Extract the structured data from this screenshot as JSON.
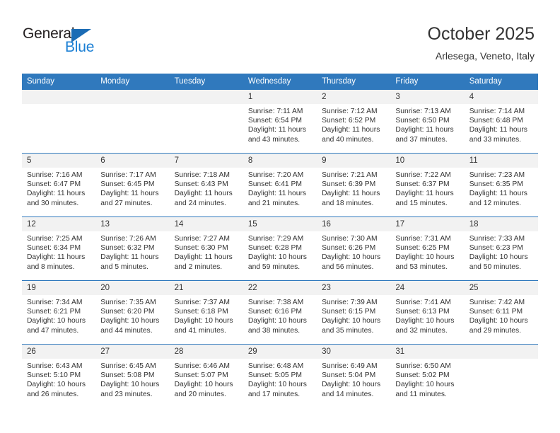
{
  "brand": {
    "name_part1": "General",
    "name_part2": "Blue",
    "accent_color": "#1b7fd4",
    "triangle_color": "#1b6cb5"
  },
  "header": {
    "title": "October 2025",
    "subtitle": "Arlesega, Veneto, Italy",
    "header_bg": "#3079bd",
    "daynum_bg": "#f2f2f2"
  },
  "weekday_headers": [
    "Sunday",
    "Monday",
    "Tuesday",
    "Wednesday",
    "Thursday",
    "Friday",
    "Saturday"
  ],
  "labels": {
    "sunrise_prefix": "Sunrise:",
    "sunset_prefix": "Sunset:",
    "daylight_prefix": "Daylight:"
  },
  "weeks": [
    [
      {
        "day": "",
        "sunrise": "",
        "sunset": "",
        "daylight_line1": "",
        "daylight_line2": ""
      },
      {
        "day": "",
        "sunrise": "",
        "sunset": "",
        "daylight_line1": "",
        "daylight_line2": ""
      },
      {
        "day": "",
        "sunrise": "",
        "sunset": "",
        "daylight_line1": "",
        "daylight_line2": ""
      },
      {
        "day": "1",
        "sunrise": "Sunrise: 7:11 AM",
        "sunset": "Sunset: 6:54 PM",
        "daylight_line1": "Daylight: 11 hours",
        "daylight_line2": "and 43 minutes."
      },
      {
        "day": "2",
        "sunrise": "Sunrise: 7:12 AM",
        "sunset": "Sunset: 6:52 PM",
        "daylight_line1": "Daylight: 11 hours",
        "daylight_line2": "and 40 minutes."
      },
      {
        "day": "3",
        "sunrise": "Sunrise: 7:13 AM",
        "sunset": "Sunset: 6:50 PM",
        "daylight_line1": "Daylight: 11 hours",
        "daylight_line2": "and 37 minutes."
      },
      {
        "day": "4",
        "sunrise": "Sunrise: 7:14 AM",
        "sunset": "Sunset: 6:48 PM",
        "daylight_line1": "Daylight: 11 hours",
        "daylight_line2": "and 33 minutes."
      }
    ],
    [
      {
        "day": "5",
        "sunrise": "Sunrise: 7:16 AM",
        "sunset": "Sunset: 6:47 PM",
        "daylight_line1": "Daylight: 11 hours",
        "daylight_line2": "and 30 minutes."
      },
      {
        "day": "6",
        "sunrise": "Sunrise: 7:17 AM",
        "sunset": "Sunset: 6:45 PM",
        "daylight_line1": "Daylight: 11 hours",
        "daylight_line2": "and 27 minutes."
      },
      {
        "day": "7",
        "sunrise": "Sunrise: 7:18 AM",
        "sunset": "Sunset: 6:43 PM",
        "daylight_line1": "Daylight: 11 hours",
        "daylight_line2": "and 24 minutes."
      },
      {
        "day": "8",
        "sunrise": "Sunrise: 7:20 AM",
        "sunset": "Sunset: 6:41 PM",
        "daylight_line1": "Daylight: 11 hours",
        "daylight_line2": "and 21 minutes."
      },
      {
        "day": "9",
        "sunrise": "Sunrise: 7:21 AM",
        "sunset": "Sunset: 6:39 PM",
        "daylight_line1": "Daylight: 11 hours",
        "daylight_line2": "and 18 minutes."
      },
      {
        "day": "10",
        "sunrise": "Sunrise: 7:22 AM",
        "sunset": "Sunset: 6:37 PM",
        "daylight_line1": "Daylight: 11 hours",
        "daylight_line2": "and 15 minutes."
      },
      {
        "day": "11",
        "sunrise": "Sunrise: 7:23 AM",
        "sunset": "Sunset: 6:35 PM",
        "daylight_line1": "Daylight: 11 hours",
        "daylight_line2": "and 12 minutes."
      }
    ],
    [
      {
        "day": "12",
        "sunrise": "Sunrise: 7:25 AM",
        "sunset": "Sunset: 6:34 PM",
        "daylight_line1": "Daylight: 11 hours",
        "daylight_line2": "and 8 minutes."
      },
      {
        "day": "13",
        "sunrise": "Sunrise: 7:26 AM",
        "sunset": "Sunset: 6:32 PM",
        "daylight_line1": "Daylight: 11 hours",
        "daylight_line2": "and 5 minutes."
      },
      {
        "day": "14",
        "sunrise": "Sunrise: 7:27 AM",
        "sunset": "Sunset: 6:30 PM",
        "daylight_line1": "Daylight: 11 hours",
        "daylight_line2": "and 2 minutes."
      },
      {
        "day": "15",
        "sunrise": "Sunrise: 7:29 AM",
        "sunset": "Sunset: 6:28 PM",
        "daylight_line1": "Daylight: 10 hours",
        "daylight_line2": "and 59 minutes."
      },
      {
        "day": "16",
        "sunrise": "Sunrise: 7:30 AM",
        "sunset": "Sunset: 6:26 PM",
        "daylight_line1": "Daylight: 10 hours",
        "daylight_line2": "and 56 minutes."
      },
      {
        "day": "17",
        "sunrise": "Sunrise: 7:31 AM",
        "sunset": "Sunset: 6:25 PM",
        "daylight_line1": "Daylight: 10 hours",
        "daylight_line2": "and 53 minutes."
      },
      {
        "day": "18",
        "sunrise": "Sunrise: 7:33 AM",
        "sunset": "Sunset: 6:23 PM",
        "daylight_line1": "Daylight: 10 hours",
        "daylight_line2": "and 50 minutes."
      }
    ],
    [
      {
        "day": "19",
        "sunrise": "Sunrise: 7:34 AM",
        "sunset": "Sunset: 6:21 PM",
        "daylight_line1": "Daylight: 10 hours",
        "daylight_line2": "and 47 minutes."
      },
      {
        "day": "20",
        "sunrise": "Sunrise: 7:35 AM",
        "sunset": "Sunset: 6:20 PM",
        "daylight_line1": "Daylight: 10 hours",
        "daylight_line2": "and 44 minutes."
      },
      {
        "day": "21",
        "sunrise": "Sunrise: 7:37 AM",
        "sunset": "Sunset: 6:18 PM",
        "daylight_line1": "Daylight: 10 hours",
        "daylight_line2": "and 41 minutes."
      },
      {
        "day": "22",
        "sunrise": "Sunrise: 7:38 AM",
        "sunset": "Sunset: 6:16 PM",
        "daylight_line1": "Daylight: 10 hours",
        "daylight_line2": "and 38 minutes."
      },
      {
        "day": "23",
        "sunrise": "Sunrise: 7:39 AM",
        "sunset": "Sunset: 6:15 PM",
        "daylight_line1": "Daylight: 10 hours",
        "daylight_line2": "and 35 minutes."
      },
      {
        "day": "24",
        "sunrise": "Sunrise: 7:41 AM",
        "sunset": "Sunset: 6:13 PM",
        "daylight_line1": "Daylight: 10 hours",
        "daylight_line2": "and 32 minutes."
      },
      {
        "day": "25",
        "sunrise": "Sunrise: 7:42 AM",
        "sunset": "Sunset: 6:11 PM",
        "daylight_line1": "Daylight: 10 hours",
        "daylight_line2": "and 29 minutes."
      }
    ],
    [
      {
        "day": "26",
        "sunrise": "Sunrise: 6:43 AM",
        "sunset": "Sunset: 5:10 PM",
        "daylight_line1": "Daylight: 10 hours",
        "daylight_line2": "and 26 minutes."
      },
      {
        "day": "27",
        "sunrise": "Sunrise: 6:45 AM",
        "sunset": "Sunset: 5:08 PM",
        "daylight_line1": "Daylight: 10 hours",
        "daylight_line2": "and 23 minutes."
      },
      {
        "day": "28",
        "sunrise": "Sunrise: 6:46 AM",
        "sunset": "Sunset: 5:07 PM",
        "daylight_line1": "Daylight: 10 hours",
        "daylight_line2": "and 20 minutes."
      },
      {
        "day": "29",
        "sunrise": "Sunrise: 6:48 AM",
        "sunset": "Sunset: 5:05 PM",
        "daylight_line1": "Daylight: 10 hours",
        "daylight_line2": "and 17 minutes."
      },
      {
        "day": "30",
        "sunrise": "Sunrise: 6:49 AM",
        "sunset": "Sunset: 5:04 PM",
        "daylight_line1": "Daylight: 10 hours",
        "daylight_line2": "and 14 minutes."
      },
      {
        "day": "31",
        "sunrise": "Sunrise: 6:50 AM",
        "sunset": "Sunset: 5:02 PM",
        "daylight_line1": "Daylight: 10 hours",
        "daylight_line2": "and 11 minutes."
      },
      {
        "day": "",
        "sunrise": "",
        "sunset": "",
        "daylight_line1": "",
        "daylight_line2": ""
      }
    ]
  ]
}
